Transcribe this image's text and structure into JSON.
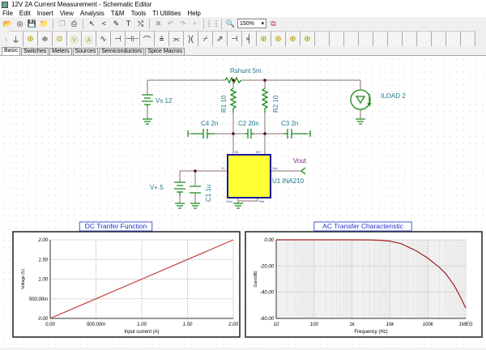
{
  "window": {
    "title": "12V  2A Current Measurement - Schematic Editor"
  },
  "menu": [
    "File",
    "Edit",
    "Insert",
    "View",
    "Analysis",
    "T&M",
    "Tools",
    "TI Utilities",
    "Help"
  ],
  "toolbar": {
    "items": [
      {
        "icon": "open-folder-icon",
        "glyph": "📂"
      },
      {
        "icon": "tina-icon",
        "glyph": "◎"
      },
      {
        "icon": "save-icon",
        "glyph": "💾"
      },
      {
        "icon": "open-icon",
        "glyph": "📁"
      },
      {
        "sep": true
      },
      {
        "icon": "copy-icon",
        "glyph": "❐",
        "disabled": true
      },
      {
        "icon": "print-preview-icon",
        "glyph": "⎙"
      },
      {
        "sep": true
      },
      {
        "icon": "pointer-icon",
        "glyph": "↖"
      },
      {
        "icon": "wire-icon",
        "glyph": "<"
      },
      {
        "icon": "pencil-icon",
        "glyph": "✎"
      },
      {
        "icon": "text-icon",
        "glyph": "T"
      },
      {
        "icon": "swap-icon",
        "glyph": "⤭"
      },
      {
        "sep": true
      },
      {
        "icon": "delete-icon",
        "glyph": "✖",
        "disabled": true
      },
      {
        "icon": "undo-icon",
        "glyph": "↶",
        "disabled": true
      },
      {
        "icon": "redo-icon",
        "glyph": "↷",
        "disabled": true
      },
      {
        "icon": "plus-icon",
        "glyph": "+",
        "disabled": true
      },
      {
        "sep": true
      },
      {
        "icon": "grid-icon",
        "glyph": "⋮⋮"
      },
      {
        "sep": true
      },
      {
        "icon": "zoom-icon",
        "glyph": "🔍"
      }
    ],
    "zoom_value": "150%",
    "component_icon": "component-icon"
  },
  "components": [
    {
      "icon": "ground-icon",
      "glyph": "⏚"
    },
    {
      "icon": "voltage-probe-icon",
      "glyph": "⊕",
      "y": true
    },
    {
      "icon": "battery-icon",
      "glyph": "≑"
    },
    {
      "icon": "ammeter-icon",
      "glyph": "⊘",
      "y": true
    },
    {
      "icon": "voltmeter-icon",
      "glyph": "Ⓥ",
      "y": true
    },
    {
      "icon": "ammeter-a-icon",
      "glyph": "Ⓐ",
      "y": true
    },
    {
      "icon": "resistor-icon",
      "glyph": "∿"
    },
    {
      "icon": "potentiometer-icon",
      "glyph": "⊣"
    },
    {
      "icon": "capacitor-icon",
      "glyph": "⊣⊢"
    },
    {
      "icon": "inductor-icon",
      "glyph": "⌒"
    },
    {
      "icon": "transformer-icon",
      "glyph": "⩮"
    },
    {
      "icon": "relay-icon",
      "glyph": "⫘"
    },
    {
      "icon": "crystal-icon",
      "glyph": ")("
    },
    {
      "icon": "switch-icon",
      "glyph": "⌿"
    },
    {
      "icon": "variable-icon",
      "glyph": "⇗"
    },
    {
      "icon": "diode-icon",
      "glyph": "⊣"
    },
    {
      "icon": "jumper-icon",
      "glyph": "╡"
    },
    {
      "icon": "probe-1-icon",
      "glyph": "⊕",
      "y": true
    },
    {
      "icon": "probe-2-icon",
      "glyph": "⊕",
      "y": true
    },
    {
      "icon": "probe-3-icon",
      "glyph": "⊕",
      "y": true
    },
    {
      "icon": "probe-4-icon",
      "glyph": "⊕",
      "y": true
    },
    {
      "icon": "empty-slot-icon",
      "glyph": ""
    },
    {
      "icon": "empty-slot-icon",
      "glyph": ""
    },
    {
      "icon": "empty-slot-icon",
      "glyph": ""
    },
    {
      "icon": "empty-slot-icon",
      "glyph": ""
    },
    {
      "icon": "empty-slot-icon",
      "glyph": ""
    },
    {
      "icon": "empty-slot-icon",
      "glyph": ""
    },
    {
      "icon": "empty-slot-icon",
      "glyph": ""
    },
    {
      "icon": "empty-slot-icon",
      "glyph": ""
    },
    {
      "icon": "empty-slot-icon",
      "glyph": ""
    },
    {
      "icon": "empty-slot-icon",
      "glyph": ""
    },
    {
      "icon": "empty-slot-icon",
      "glyph": ""
    }
  ],
  "tabs": [
    {
      "label": "Basic",
      "active": true
    },
    {
      "label": "Switches"
    },
    {
      "label": "Meters"
    },
    {
      "label": "Sources"
    },
    {
      "label": "Semiconductors"
    },
    {
      "label": "Spice Macros"
    }
  ],
  "schematic": {
    "rshunt": "Rshunt 5m",
    "vs": "Vs 12",
    "r1": "R1 10",
    "r2": "R2 10",
    "c4": "C4 2n",
    "c2": "C2 20n",
    "c3": "C3 2n",
    "iload": "ILOAD 2",
    "vout": "Vout",
    "u1": "U1 INA210",
    "vplus": "V+ 5",
    "c1": "C1 1u",
    "pins": {
      "inm": "IN-",
      "inp": "IN+",
      "vp": "V+",
      "out": "Out",
      "gnd": "Gnd",
      "ref": "Ref"
    },
    "colors": {
      "wire": "#8b6f6f",
      "component": "#1a8a1a",
      "label": "#1a7a8a",
      "chip": "#ffff33",
      "chip_border": "#1a1a99",
      "vout": "#8a2a8a"
    }
  },
  "chart_data": [
    {
      "type": "line",
      "title": "DC Tranfer Function",
      "xlabel": "Input current (A)",
      "ylabel": "Voltage (V)",
      "xlim": [
        0,
        2
      ],
      "ylim": [
        0,
        2
      ],
      "grid": true,
      "xticks": [
        "0.00",
        "500.00m",
        "1.00",
        "1.50",
        "2.00"
      ],
      "yticks": [
        "0.00",
        "500.00m",
        "1.00",
        "1.50",
        "2.00"
      ],
      "x": [
        0,
        2
      ],
      "y": [
        0,
        2
      ],
      "color": "#c04040"
    },
    {
      "type": "line",
      "title": "AC Transfer Characteristic",
      "xlabel": "Frequency (Hz)",
      "ylabel": "Gain(dB)",
      "xscale": "log",
      "xlim": [
        10,
        1000000
      ],
      "ylim": [
        -60,
        0
      ],
      "grid": true,
      "xticks": [
        "10",
        "100",
        "1k",
        "10k",
        "100k",
        "1MEG"
      ],
      "yticks": [
        "0.00",
        "-20.00",
        "-40.00",
        "-60.00"
      ],
      "x": [
        10,
        100,
        1000,
        3000,
        6000,
        10000,
        20000,
        50000,
        100000,
        200000,
        300000,
        500000,
        700000,
        1000000
      ],
      "y": [
        0,
        0,
        0,
        -0.1,
        -0.4,
        -1,
        -3,
        -8.5,
        -14,
        -21,
        -26,
        -35,
        -43,
        -52
      ],
      "color": "#a02020"
    }
  ]
}
